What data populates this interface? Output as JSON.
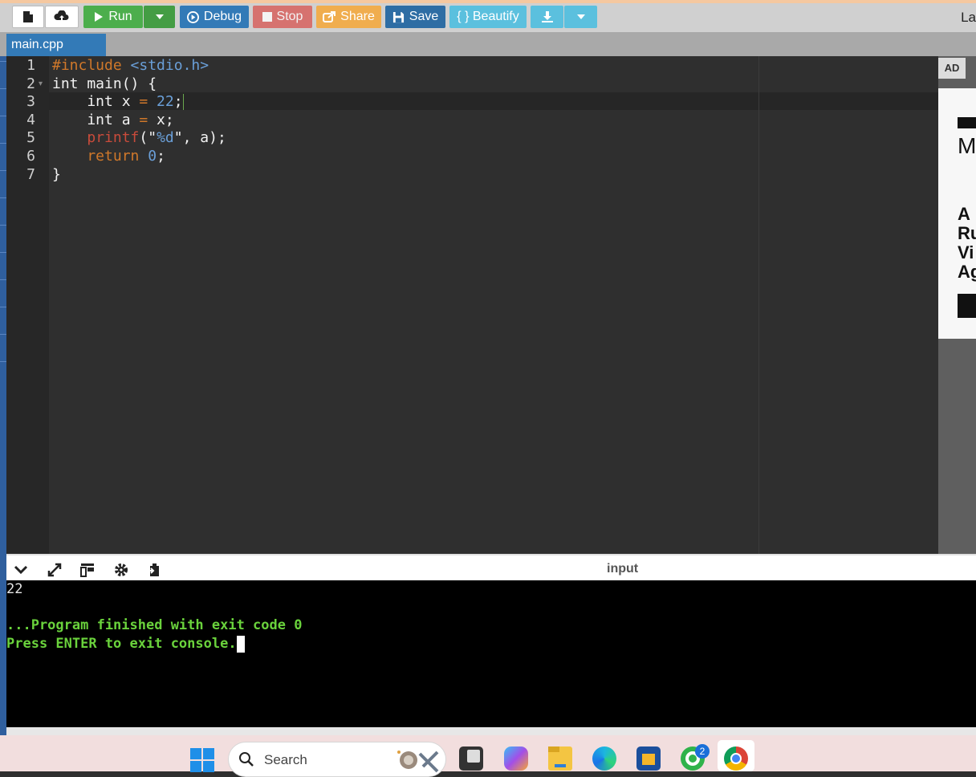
{
  "toolbar": {
    "run_label": "Run",
    "debug_label": "Debug",
    "stop_label": "Stop",
    "share_label": "Share",
    "save_label": "Save",
    "beautify_label": "{ } Beautify",
    "language_partial": "La"
  },
  "tabs": [
    {
      "label": "main.cpp"
    }
  ],
  "editor": {
    "line_numbers": [
      "1",
      "2",
      "3",
      "4",
      "5",
      "6",
      "7"
    ],
    "lines": [
      "#include <stdio.h>",
      "int main() {",
      "    int x = 22;",
      "    int a = x;",
      "    printf(\"%d\", a);",
      "    return 0;",
      "}"
    ]
  },
  "ad": {
    "label": "AD",
    "visible_fragments": [
      "M",
      "A",
      "Ru",
      "Vi",
      "Ag"
    ]
  },
  "console": {
    "input_label": "input",
    "output": "22",
    "finished": "...Program finished with exit code 0",
    "press_enter": "Press ENTER to exit console."
  },
  "taskbar": {
    "search_placeholder": "Search",
    "whatsapp_badge": "2"
  },
  "colors": {
    "run": "#4cae4c",
    "debug": "#337ab7",
    "stop": "#d9534f",
    "share": "#f0ad4e",
    "beautify": "#5bc0de",
    "console_green": "#6ad23c"
  }
}
